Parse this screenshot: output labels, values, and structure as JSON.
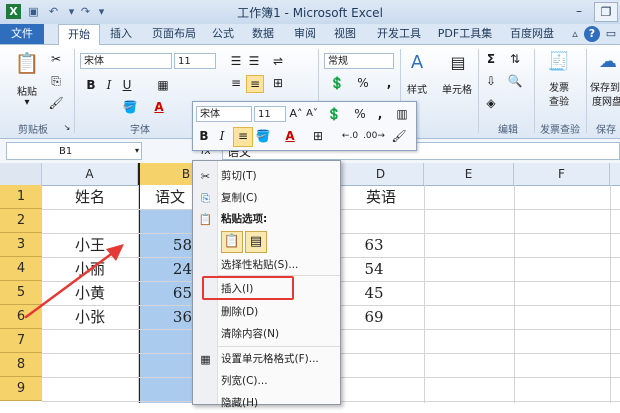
{
  "window": {
    "title": "工作簿1 - Microsoft Excel",
    "qat_icons": [
      "excel-logo-icon",
      "save-icon",
      "undo-icon",
      "redo-icon",
      "customize-icon"
    ]
  },
  "tabs": [
    "文件",
    "开始",
    "插入",
    "页面布局",
    "公式",
    "数据",
    "审阅",
    "视图",
    "开发工具",
    "PDF工具集",
    "百度网盘"
  ],
  "ribbon": {
    "paste_label": "粘贴",
    "clipboard_group": "剪贴板",
    "font_group": "字体",
    "font_name": "宋体",
    "font_size": "11",
    "number_format": "常规",
    "style_label": "样式",
    "cells_label": "单元格",
    "edit_group": "编辑",
    "invoice_btn": "发票查验",
    "invoice_line1": "发票",
    "invoice_line2": "查验",
    "invoice_group": "发票查验",
    "save_line1": "保存到",
    "save_line2": "度网盘",
    "save_group": "保存",
    "align_percent": "%",
    "comma": ","
  },
  "mini_toolbar": {
    "font_name": "宋体",
    "font_size": "11",
    "percent": "%",
    "comma": ","
  },
  "formula_bar": {
    "name_box": "B1",
    "fx": "fx",
    "value": "语文"
  },
  "columns": [
    "A",
    "B",
    "C",
    "D",
    "E",
    "F"
  ],
  "rows": [
    "1",
    "2",
    "3",
    "4",
    "5",
    "6",
    "7",
    "8",
    "9"
  ],
  "cells": {
    "A1": "姓名",
    "B1": "语文",
    "D1": "英语",
    "A3": "小王",
    "B3": "58",
    "D3": "63",
    "A4": "小丽",
    "B4": "24",
    "D4": "54",
    "A5": "小黄",
    "B5": "65",
    "D5": "45",
    "A6": "小张",
    "B6": "36",
    "D6": "69"
  },
  "context_menu": {
    "cut": "剪切(T)",
    "copy": "复制(C)",
    "paste_options": "粘贴选项:",
    "paste_special": "选择性粘贴(S)...",
    "insert": "插入(I)",
    "delete": "删除(D)",
    "clear": "清除内容(N)",
    "format_cells": "设置单元格格式(F)...",
    "col_width": "列宽(C)...",
    "hide": "隐藏(H)"
  },
  "colors": {
    "selection": "#aacbee",
    "row_header_highlight": "#f5d36a",
    "annotation_red": "#e53935",
    "file_tab": "#2f6ebd"
  }
}
